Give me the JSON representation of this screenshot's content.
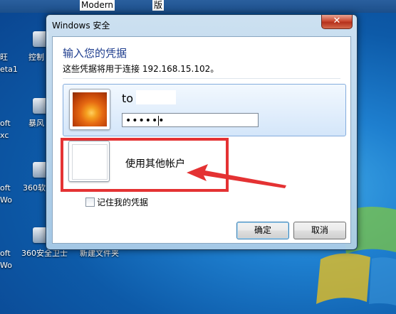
{
  "desktop": {
    "top_labels": [
      "Modern",
      "版"
    ],
    "left_labels": [
      "旺",
      "eta1",
      "oft",
      "xc",
      "oft",
      "Wo",
      "oft",
      "Wo"
    ],
    "icon_labels": [
      "控制",
      "暴风",
      "360软",
      "360安全卫士",
      "新建文件夹"
    ]
  },
  "dialog": {
    "title": "Windows 安全",
    "close_icon": "close-icon",
    "heading": "输入您的凭据",
    "subheading": "这些凭据将用于连接 192.168.15.102。",
    "selected_account": {
      "username": "to",
      "password_mask": "••••••"
    },
    "other_account_label": "使用其他帐户",
    "remember_label": "记住我的凭据",
    "remember_checked": false,
    "ok_label": "确定",
    "cancel_label": "取消"
  },
  "annotation": {
    "box_color": "#e43233"
  }
}
